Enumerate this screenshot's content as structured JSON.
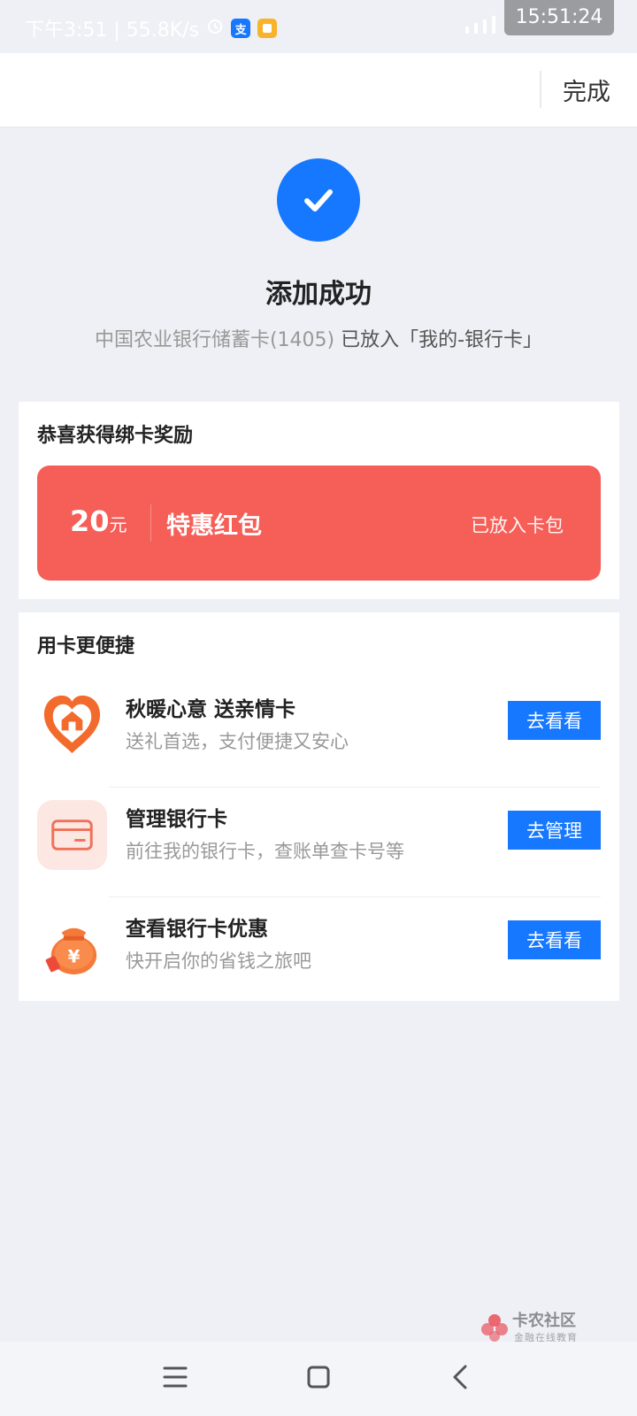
{
  "status_bar": {
    "left_text": "下午3:51 | 55.8K/s",
    "clock": "15:51:24",
    "alipay_glyph": "支"
  },
  "header": {
    "done_label": "完成"
  },
  "success": {
    "title": "添加成功",
    "card_name": "中国农业银行储蓄卡(1405)",
    "card_suffix": " 已放入「我的-银行卡」",
    "icon": "check-icon",
    "color": "#1677ff"
  },
  "reward": {
    "title": "恭喜获得绑卡奖励",
    "amount": "20",
    "unit": "元",
    "name": "特惠红包",
    "status": "已放入卡包",
    "color": "#f65e58"
  },
  "services": {
    "title": "用卡更便捷",
    "items": [
      {
        "title": "秋暖心意 送亲情卡",
        "desc": "送礼首选，支付便捷又安心",
        "button": "去看看",
        "icon": "heart-home-icon"
      },
      {
        "title": "管理银行卡",
        "desc": "前往我的银行卡，查账单查卡号等",
        "button": "去管理",
        "icon": "bank-card-icon"
      },
      {
        "title": "查看银行卡优惠",
        "desc": "快开启你的省钱之旅吧",
        "button": "去看看",
        "icon": "money-bag-icon"
      }
    ]
  },
  "watermark": {
    "title": "卡农社区",
    "subtitle": "金融在线教育"
  },
  "nav": {
    "menu_icon": "menu-icon",
    "home_icon": "home-icon",
    "back_icon": "back-icon"
  }
}
